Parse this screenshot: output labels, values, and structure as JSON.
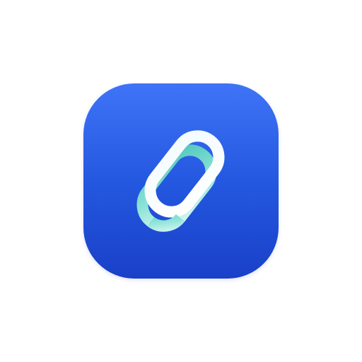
{
  "app_icon": {
    "icon": "link-chain-icon",
    "colors": {
      "background_top": "#3f74f7",
      "background_bottom": "#1a40c8",
      "front_link": "#ffffff",
      "back_link_light": "#dffaf6",
      "back_link_dark": "#5fd3c4"
    }
  }
}
